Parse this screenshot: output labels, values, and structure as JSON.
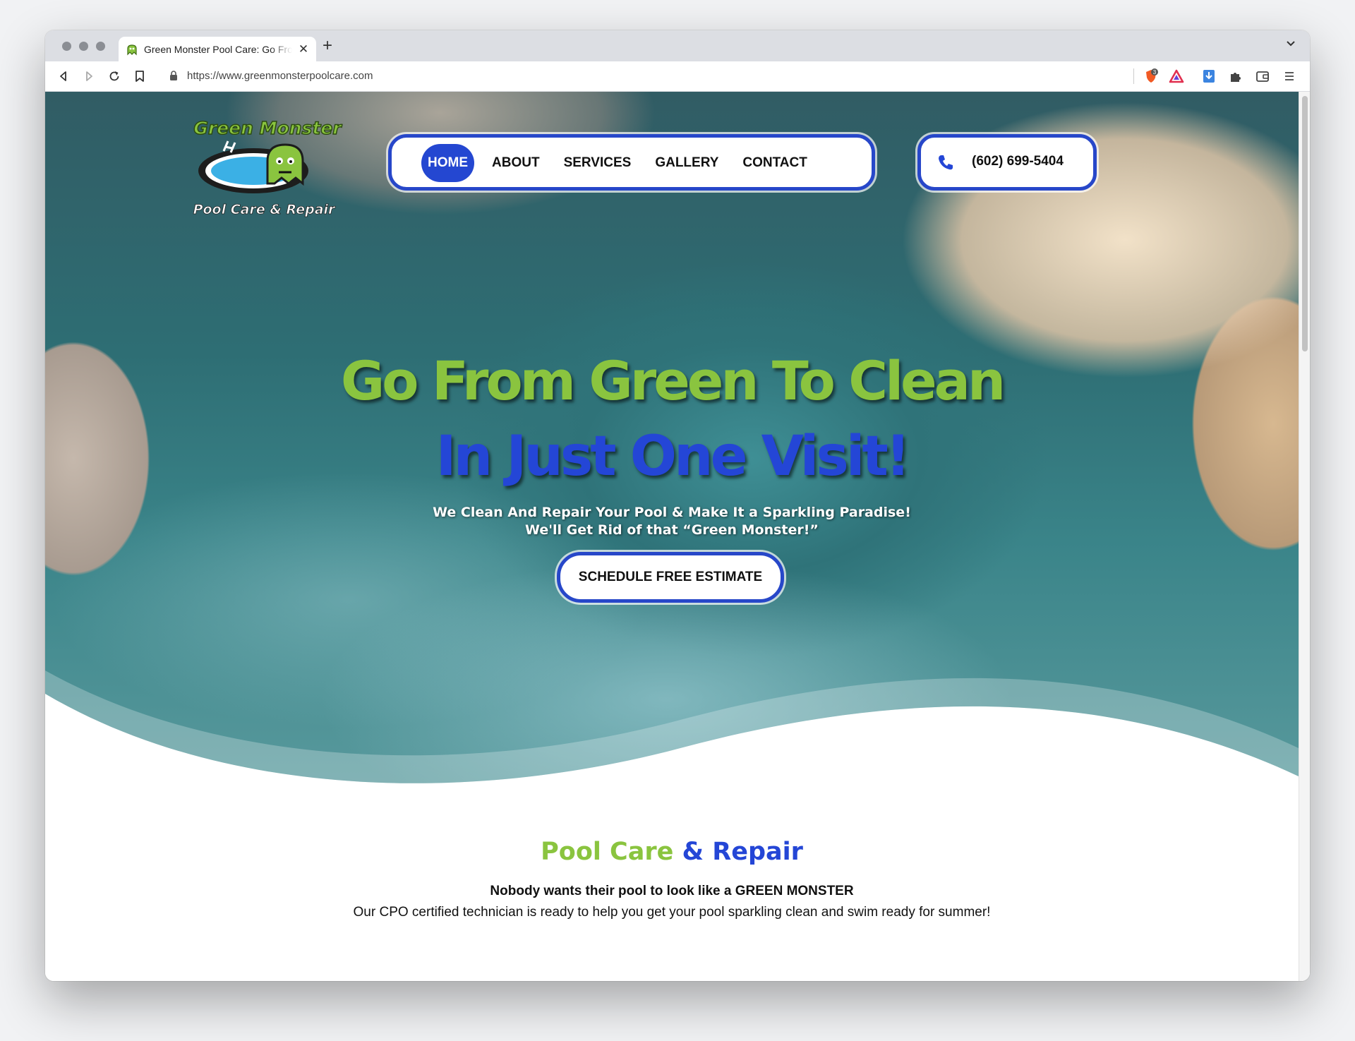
{
  "browser": {
    "tab_title": "Green Monster Pool Care: Go From Green To Clean",
    "url": "https://www.greenmonsterpoolcare.com",
    "new_tab": "+",
    "close": "✕",
    "extension_badge": "3"
  },
  "logo": {
    "line1": "Green Monster",
    "line2": "Pool Care & Repair"
  },
  "nav": {
    "items": [
      "HOME",
      "ABOUT",
      "SERVICES",
      "GALLERY",
      "CONTACT"
    ],
    "active": "HOME"
  },
  "phone": {
    "number": "(602) 699-5404"
  },
  "hero": {
    "headline_line1": "Go From Green To Clean",
    "headline_line2": "In Just One Visit!",
    "sub_line1": "We Clean And Repair Your Pool & Make It a Sparkling Paradise!",
    "sub_line2": "We'll Get Rid of that “Green Monster!”",
    "cta_label": "SCHEDULE FREE ESTIMATE"
  },
  "section": {
    "title_part1": "Pool Care",
    "title_part2": "& Repair",
    "bold_line": "Nobody wants their pool to look like a GREEN MONSTER",
    "body": "Our CPO certified technician is ready to help you get your pool sparkling clean and swim ready for summer!"
  },
  "colors": {
    "brand_green": "#8ac43f",
    "brand_blue": "#2446d6",
    "nav_border": "#2747c9"
  }
}
